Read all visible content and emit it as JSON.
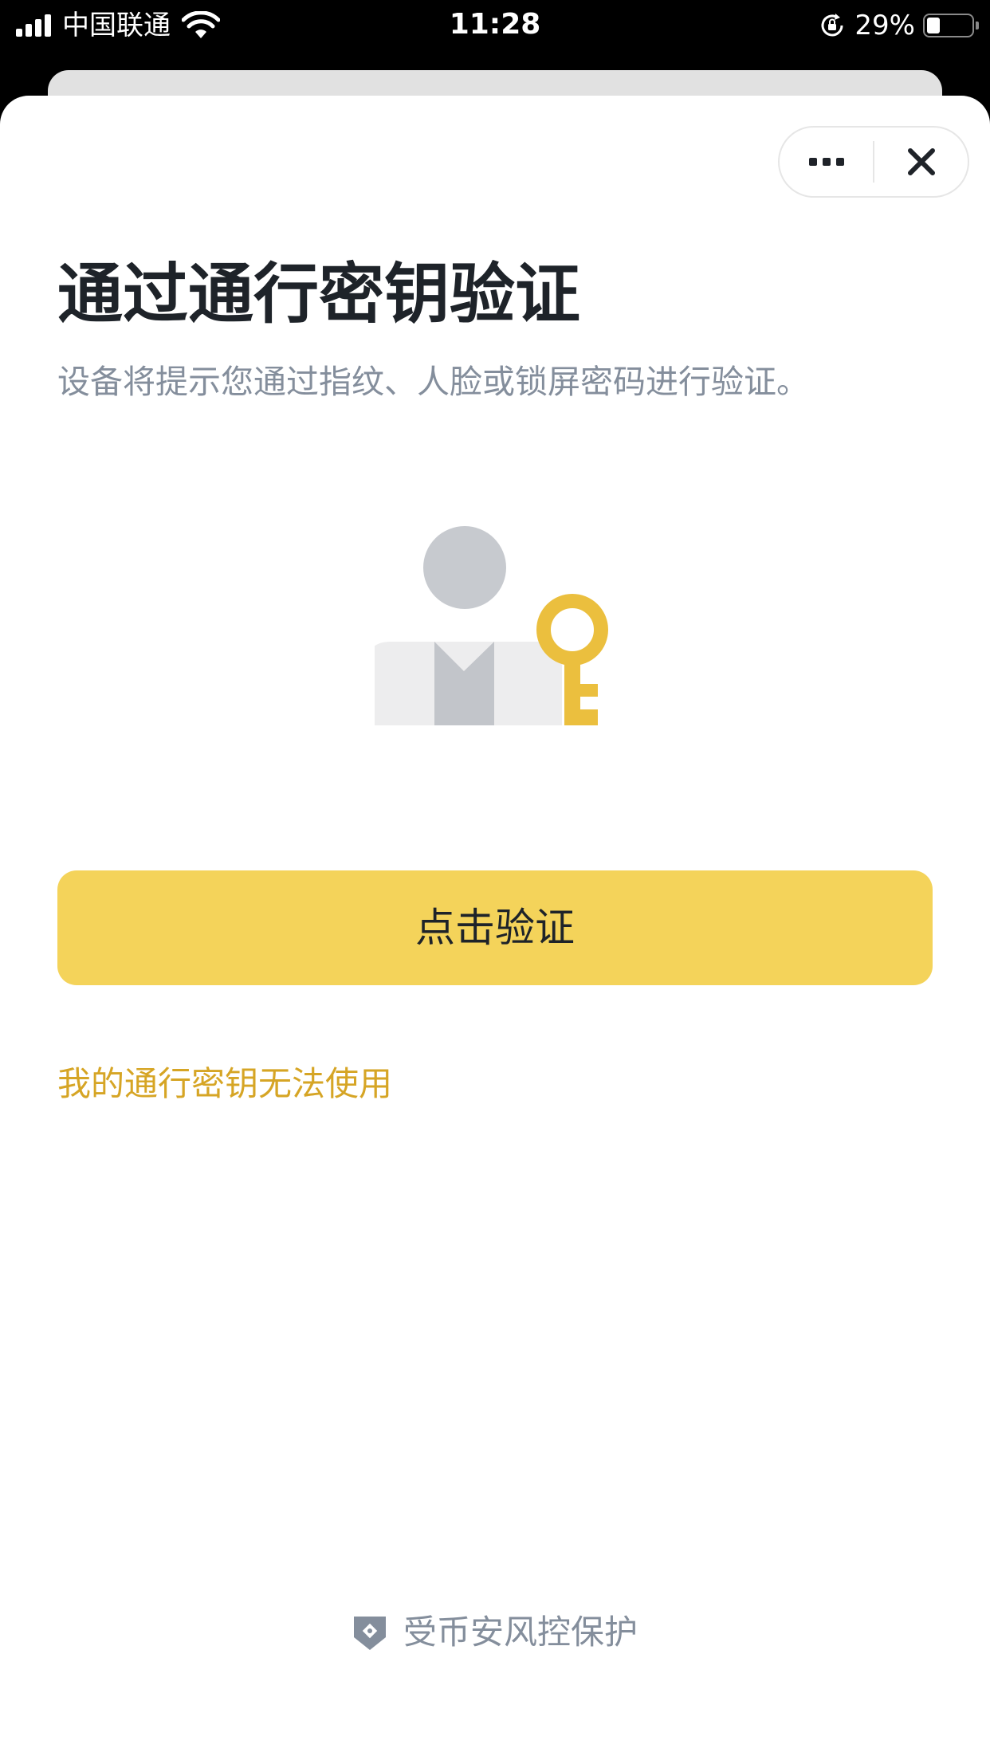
{
  "status_bar": {
    "carrier": "中国联通",
    "time": "11:28",
    "battery_percent": "29%",
    "battery_level": 0.29,
    "icons": [
      "signal-icon",
      "wifi-icon",
      "rotation-lock-icon",
      "battery-icon"
    ]
  },
  "capsule": {
    "more_icon": "more-icon",
    "close_icon": "close-icon"
  },
  "page": {
    "title": "通过通行密钥验证",
    "subtitle": "设备将提示您通过指纹、人脸或锁屏密码进行验证。",
    "illustration_icon": "person-with-key-icon",
    "verify_button": "点击验证",
    "help_link": "我的通行密钥无法使用"
  },
  "footer": {
    "shield_icon": "shield-icon",
    "text": "受币安风控保护"
  },
  "colors": {
    "accent": "#F4D35A",
    "link": "#D6A525",
    "key": "#EBBF3E",
    "title": "#1E2329",
    "secondary_text": "#848E9C"
  }
}
